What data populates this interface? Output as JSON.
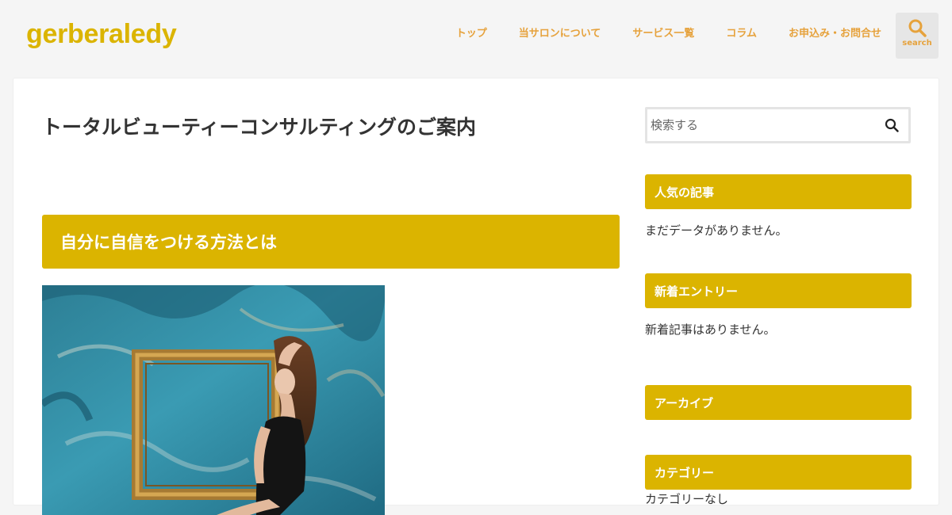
{
  "header": {
    "site_title": "gerberaledy",
    "nav": [
      "トップ",
      "当サロンについて",
      "サービス一覧",
      "コラム",
      "お申込み・お問合せ"
    ],
    "search_label": "search"
  },
  "main": {
    "page_title": "トータルビューティーコンサルティングのご案内",
    "section_heading": "自分に自信をつける方法とは"
  },
  "sidebar": {
    "search_placeholder": "検索する",
    "popular_title": "人気の記事",
    "popular_empty": "まだデータがありません。",
    "recent_title": "新着エントリー",
    "recent_empty": "新着記事はありません。",
    "archive_title": "アーカイブ",
    "category_title": "カテゴリー",
    "category_empty": "カテゴリーなし"
  },
  "colors": {
    "accent": "#dbb400",
    "nav_text": "#e6a23c",
    "background": "#f5f5f5"
  }
}
